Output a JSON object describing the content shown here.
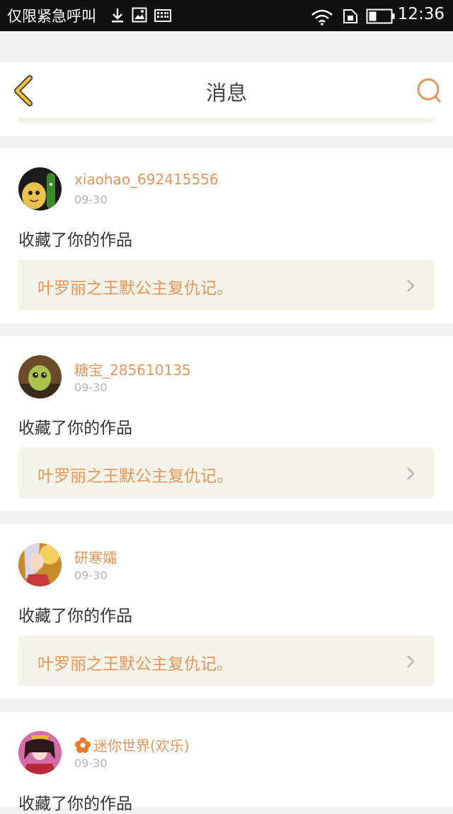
{
  "status_bar": {
    "carrier": "仅限紧急呼叫",
    "time": "12:36",
    "icons": [
      "download-icon",
      "image-icon",
      "keyboard-icon",
      "wifi-icon",
      "sim-icon",
      "battery-icon"
    ]
  },
  "header": {
    "title": "消息",
    "back_icon": "chevron-left-icon",
    "search_icon": "search-icon"
  },
  "colors": {
    "accent": "#e8955a",
    "back_icon": "#f2c230",
    "work_bg": "#f3f3ea"
  },
  "messages": [
    {
      "username": "xiaohao_692415556",
      "date": "09-30",
      "action": "收藏了你的作品",
      "work_title": "叶罗丽之王默公主复仇记。"
    },
    {
      "username": "糖宝_285610135",
      "date": "09-30",
      "action": "收藏了你的作品",
      "work_title": "叶罗丽之王默公主复仇记。"
    },
    {
      "username": "研寒孀",
      "date": "09-30",
      "action": "收藏了你的作品",
      "work_title": "叶罗丽之王默公主复仇记。"
    },
    {
      "username": "迷你世界(欢乐)",
      "date": "09-30",
      "action": "收藏了你的作品",
      "badge_icon": "flower-badge-icon"
    }
  ]
}
